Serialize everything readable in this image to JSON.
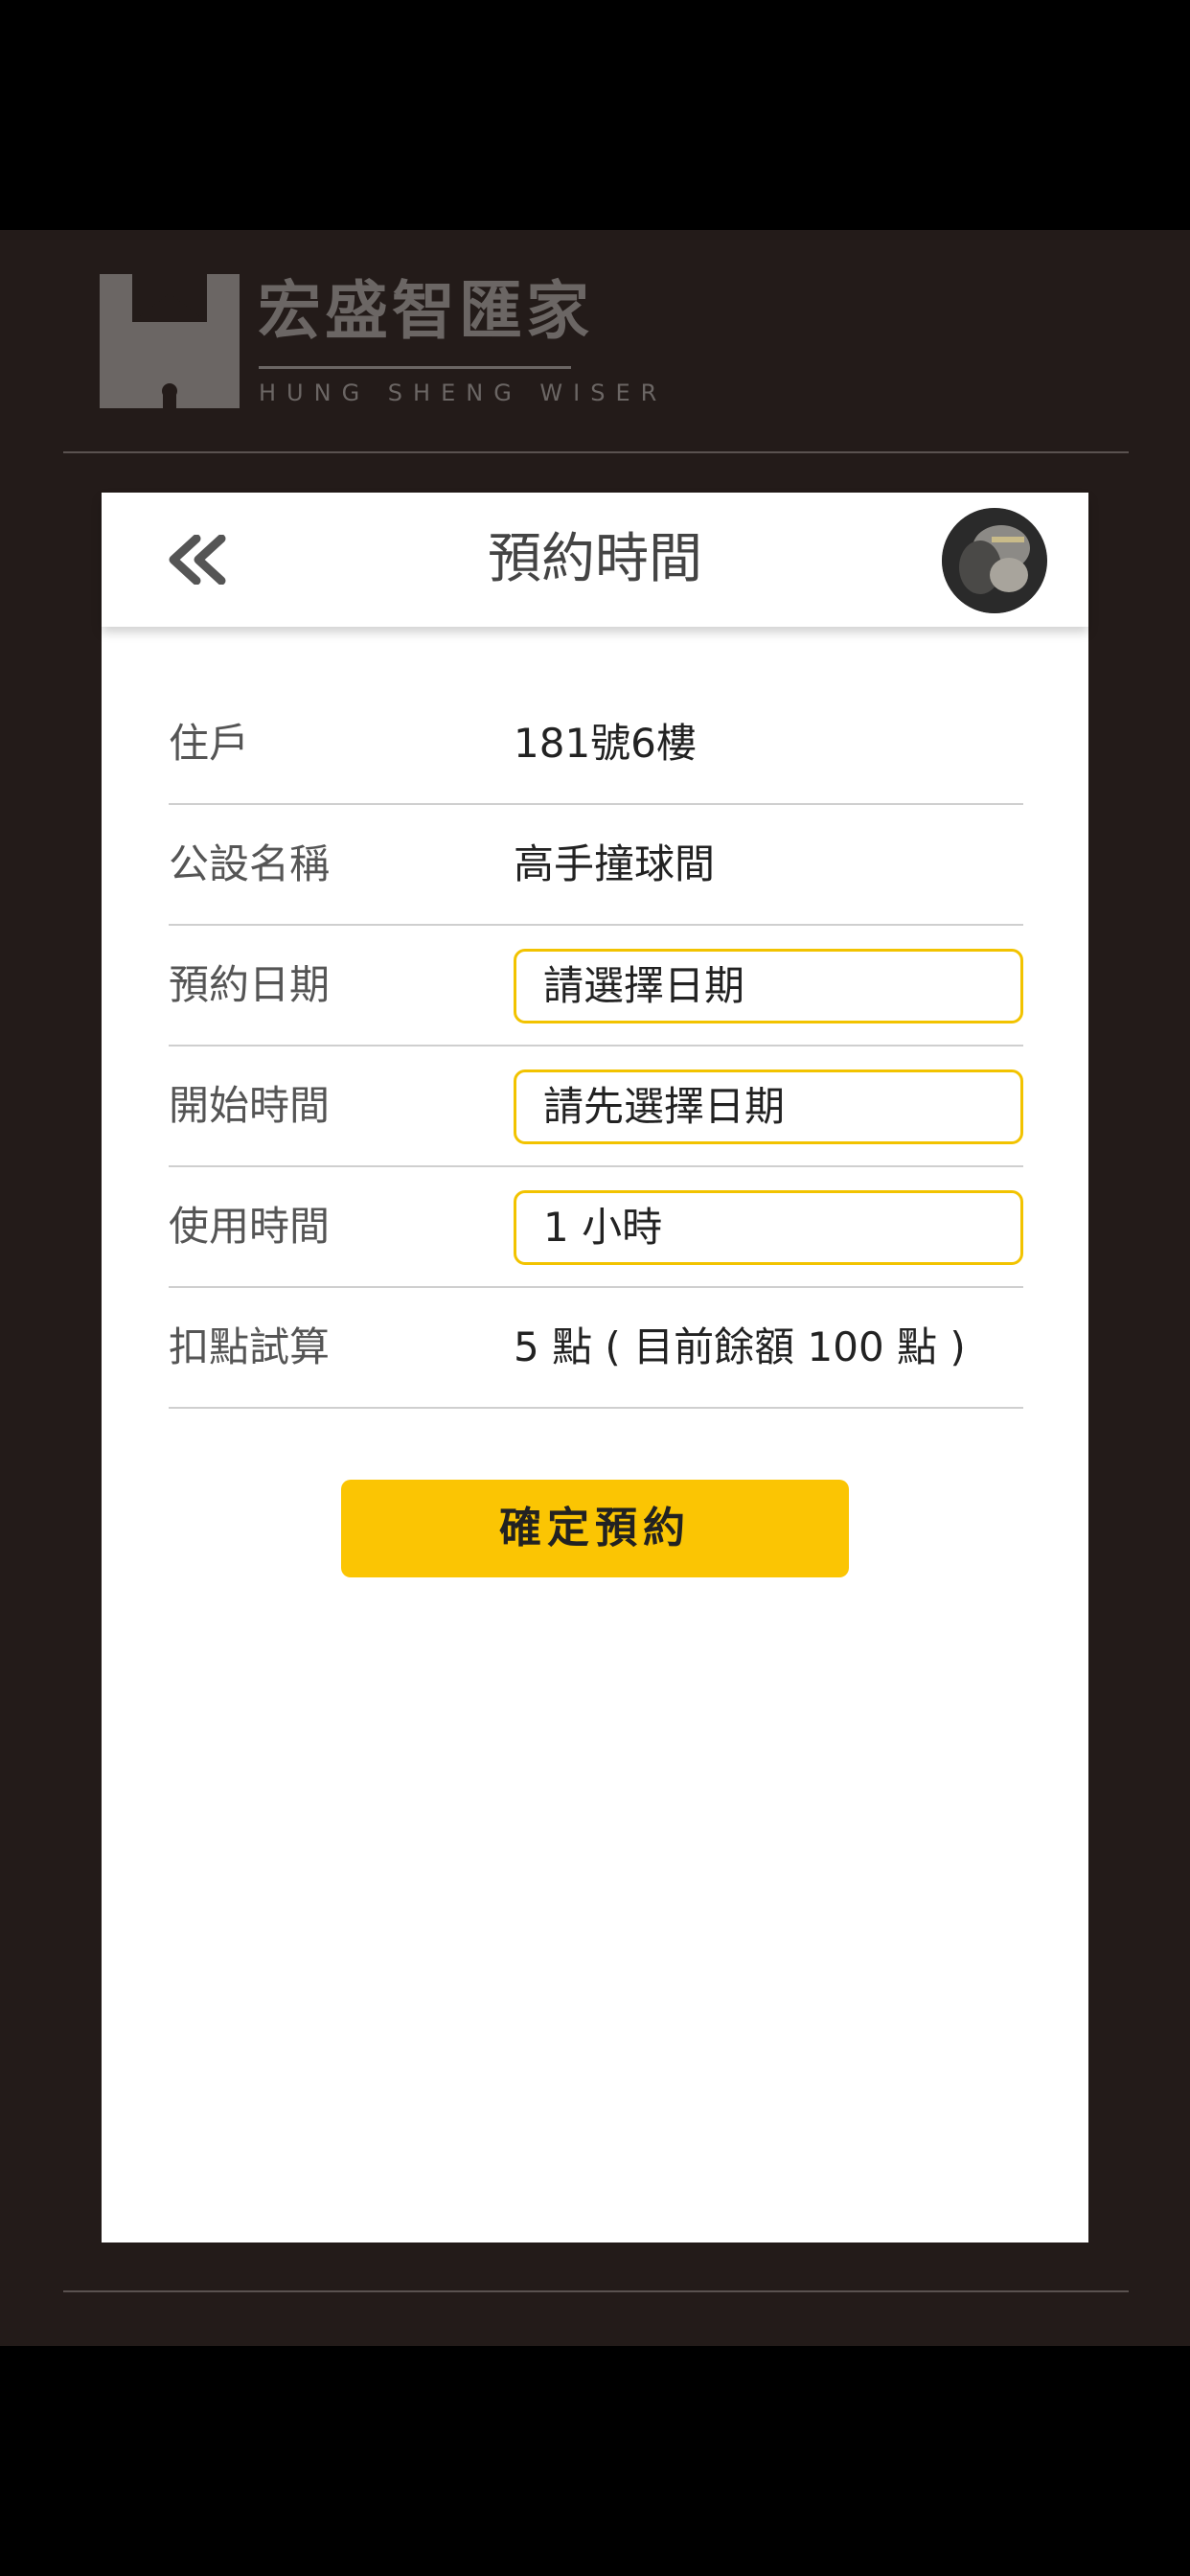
{
  "brand": {
    "name": "宏盛智匯家",
    "subtitle": "HUNG SHENG WISER",
    "color": "#6b6664"
  },
  "header": {
    "back_icon": "double-chevron-left-icon",
    "title": "預約時間"
  },
  "form": {
    "resident": {
      "label": "住戶",
      "value": "181號6樓"
    },
    "facility": {
      "label": "公設名稱",
      "value": "高手撞球間"
    },
    "date": {
      "label": "預約日期",
      "value": "請選擇日期"
    },
    "start_time": {
      "label": "開始時間",
      "value": "請先選擇日期"
    },
    "duration": {
      "label": "使用時間",
      "value": "1 小時"
    },
    "points": {
      "label": "扣點試算",
      "value": "5 點 ( 目前餘額 100 點 )"
    }
  },
  "actions": {
    "confirm_label": "確定預約"
  },
  "colors": {
    "accent": "#fbc503",
    "input_border": "#f2c300",
    "background": "#231b19",
    "card": "#ffffff"
  }
}
